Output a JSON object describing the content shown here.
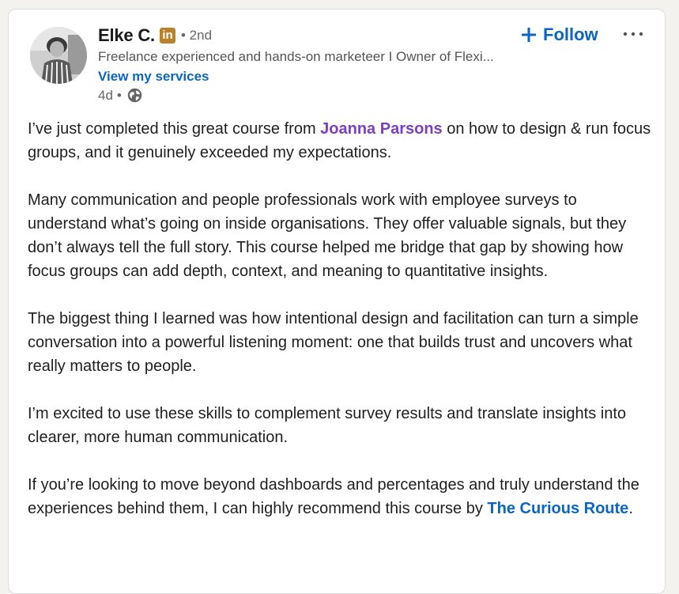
{
  "author": {
    "name": "Elke C.",
    "badge": "in",
    "degree": "• 2nd",
    "headline": "Freelance experienced and hands-on marketeer I Owner of Flexi...",
    "services_link": "View my services",
    "time": "4d",
    "dot": "•",
    "visibility_icon": "globe-icon"
  },
  "actions": {
    "follow_label": "Follow",
    "follow_icon": "plus-icon",
    "more_icon": "ellipsis-icon"
  },
  "post": {
    "p1": {
      "before": "I’ve just completed this great course from ",
      "mention": "Joanna Parsons",
      "after": " on how to design & run focus groups, and it genuinely exceeded my expectations."
    },
    "p2": "Many communication and people professionals work with employee surveys to understand what’s going on inside organisations. They offer valuable signals, but they don’t always tell the full story. This course helped me bridge that gap by showing how focus groups can add depth, context, and meaning to quantitative insights.",
    "p3": "The biggest thing I learned was how intentional design and facilitation can turn a simple conversation into a powerful listening moment: one that builds trust and uncovers what really matters to people.",
    "p4": "I’m excited to use these skills to complement survey results and translate insights into clearer, more human communication.",
    "p5": {
      "before": "If you’re looking to move beyond dashboards and percentages and truly understand the experiences behind them, I can highly recommend this course by ",
      "company": "The Curious Route",
      "after": "."
    }
  },
  "colors": {
    "link_blue": "#0a66c2",
    "mention_purple": "#7b3fc4",
    "badge_gold": "#b8822b"
  }
}
